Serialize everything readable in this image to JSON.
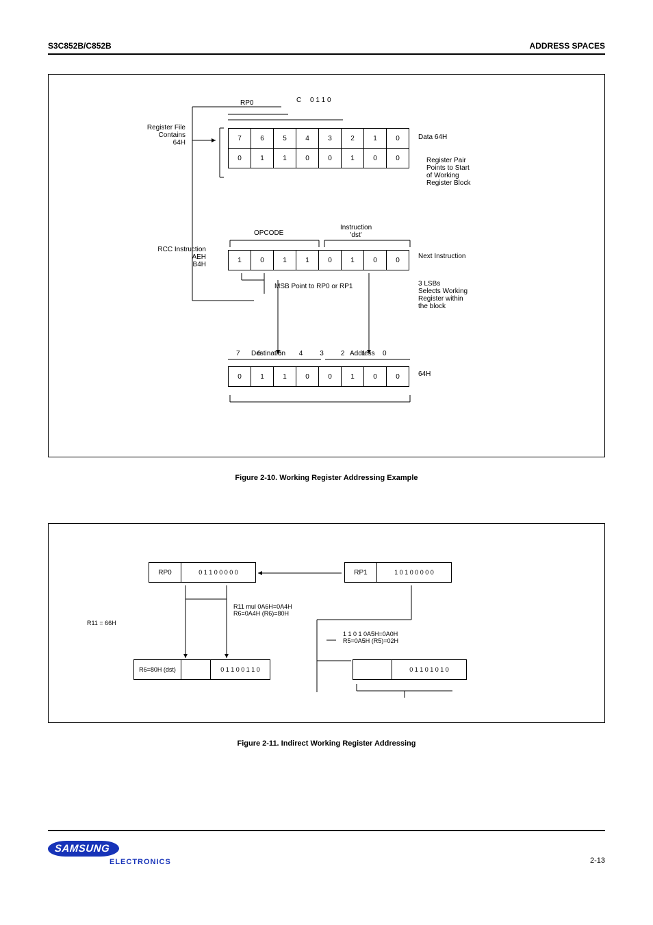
{
  "header": {
    "left": "S3C852B/C852B",
    "right": "ADDRESS SPACES"
  },
  "fig1": {
    "labels": {
      "reg_file": "Register File",
      "contains": "Contains",
      "64h_1": "64H",
      "data_64h": "Data 64H",
      "rcc_instruction": "RCC Instruction",
      "aeh": "AEH",
      "b4h": "B4H",
      "opcode": "OPCODE",
      "dst_instr": "Instruction\n'dst'",
      "next_instr": "Next Instruction",
      "msb_point": "MSB Point to RP0 or RP1",
      "rp0": "RP0",
      "c_lo": "C",
      "byte0_0110": "0 1 1 0",
      "destination": "Destination",
      "address": "Address",
      "reg_pair_pts": "Register Pair\nPoints to Start\nof Working\nRegister Block",
      "three_sel": "3 LSBs\nSelects Working\nRegister within\nthe block"
    },
    "reg_indices_1": [
      "7",
      "6",
      "5",
      "4",
      "3",
      "2",
      "1",
      "0"
    ],
    "reg_row2": [
      "0",
      "1",
      "1",
      "0",
      "0",
      "1",
      "0",
      "0"
    ],
    "instr_row": [
      "1",
      "0",
      "1",
      "1",
      "0",
      "1",
      "0",
      "0"
    ],
    "dest_row": [
      "0",
      "1",
      "1",
      "0",
      "0",
      "1",
      "0",
      "0"
    ],
    "dest_idx": [
      "7",
      "6",
      "5",
      "4",
      "3",
      "2",
      "1",
      "0"
    ],
    "caption": "Figure 2-10.  Working Register Addressing Example"
  },
  "fig2": {
    "boxes": {
      "rp0": "RP0",
      "rp1": "RP1",
      "rp0_val": "0 1 1 0 0 0 0 0",
      "rp1_val": "1 0 1 0 0 0 0 0",
      "r11_eq_66h": "R11 = 66H",
      "r11_mul_r6r6": "R11 mul 0A6H=0A4H\nR6=0A4H (R6)=80H",
      "r6_80h_dst": "R6=80H (dst)",
      "r6_val": "0 1 1 0 0 1 1 0",
      "r1101_eval": "1 1 0 1 0A5H=0A0H\nR5=0A5H (R5)=02H",
      "r6_r6_val": "0 1 1 0 1 0 1 0"
    },
    "caption": "Figure 2-11.  Indirect Working Register Addressing"
  },
  "footer": {
    "samsung": "SAMSUNG",
    "electronics": "ELECTRONICS",
    "page": "2-13"
  }
}
